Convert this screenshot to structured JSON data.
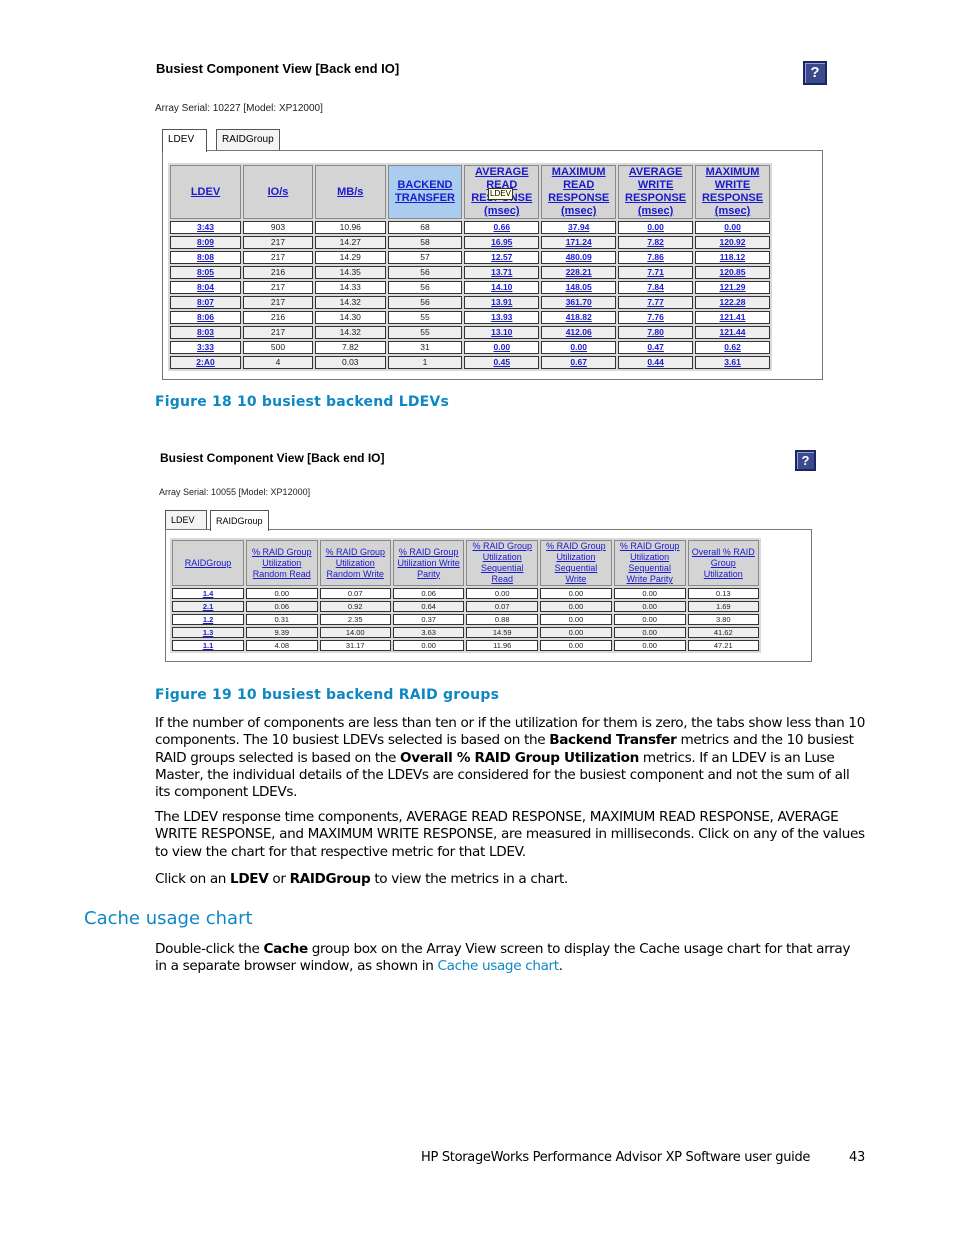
{
  "figure1": {
    "title": "Busiest Component View [Back end IO]",
    "serial": "Array Serial: 10227 [Model: XP12000]",
    "help_label": "?",
    "tabs": [
      {
        "label": "LDEV",
        "active": true
      },
      {
        "label": "RAIDGroup",
        "active": false
      }
    ],
    "tooltip": "LDEV",
    "columns": [
      "LDEV",
      "IO/s",
      "MB/s",
      "BACKEND TRANSFER",
      "AVERAGE READ RESPONSE (msec)",
      "MAXIMUM READ RESPONSE (msec)",
      "AVERAGE WRITE RESPONSE (msec)",
      "MAXIMUM WRITE RESPONSE (msec)"
    ],
    "highlighted_column": "BACKEND TRANSFER",
    "rows": [
      [
        "3:43",
        "903",
        "10.96",
        "68",
        "0.66",
        "37.94",
        "0.00",
        "0.00"
      ],
      [
        "8:09",
        "217",
        "14.27",
        "58",
        "16.95",
        "171.24",
        "7.82",
        "120.92"
      ],
      [
        "8:08",
        "217",
        "14.29",
        "57",
        "12.57",
        "480.09",
        "7.86",
        "118.12"
      ],
      [
        "8:05",
        "216",
        "14.35",
        "56",
        "13.71",
        "228.21",
        "7.71",
        "120.85"
      ],
      [
        "8:04",
        "217",
        "14.33",
        "56",
        "14.10",
        "148.05",
        "7.84",
        "121.29"
      ],
      [
        "8:07",
        "217",
        "14.32",
        "56",
        "13.91",
        "361.70",
        "7.77",
        "122.28"
      ],
      [
        "8:06",
        "216",
        "14.30",
        "55",
        "13.93",
        "418.82",
        "7.76",
        "121.41"
      ],
      [
        "8:03",
        "217",
        "14.32",
        "55",
        "13.10",
        "412.06",
        "7.80",
        "121.44"
      ],
      [
        "3:33",
        "500",
        "7.82",
        "31",
        "0.00",
        "0.00",
        "0.47",
        "0.62"
      ],
      [
        "2:A0",
        "4",
        "0.03",
        "1",
        "0.45",
        "0.67",
        "0.44",
        "3.61"
      ]
    ],
    "caption": "Figure 18 10 busiest backend LDEVs"
  },
  "figure2": {
    "title": "Busiest Component View [Back end IO]",
    "serial": "Array Serial: 10055 [Model: XP12000]",
    "help_label": "?",
    "tabs": [
      {
        "label": "LDEV",
        "active": false
      },
      {
        "label": "RAIDGroup",
        "active": true
      }
    ],
    "columns": [
      "RAIDGroup",
      "% RAID Group Utilization Random Read",
      "% RAID Group Utilization Random Write",
      "% RAID Group Utilization Write Parity",
      "% RAID Group Utilization Sequential Read",
      "% RAID Group Utilization Sequential Write",
      "% RAID Group Utilization Sequential Write Parity",
      "Overall % RAID Group Utilization"
    ],
    "rows": [
      [
        "1.4",
        "0.00",
        "0.07",
        "0.06",
        "0.00",
        "0.00",
        "0.00",
        "0.13"
      ],
      [
        "2.1",
        "0.06",
        "0.92",
        "0.64",
        "0.07",
        "0.00",
        "0.00",
        "1.69"
      ],
      [
        "1.2",
        "0.31",
        "2.35",
        "0.37",
        "0.88",
        "0.00",
        "0.00",
        "3.80"
      ],
      [
        "1.3",
        "9.39",
        "14.00",
        "3.63",
        "14.59",
        "0.00",
        "0.00",
        "41.62"
      ],
      [
        "1.1",
        "4.08",
        "31.17",
        "0.00",
        "11.96",
        "0.00",
        "0.00",
        "47.21"
      ]
    ],
    "caption": "Figure 19 10 busiest backend RAID groups"
  },
  "body": {
    "p1": {
      "t1": "If the number of components are less than ten or if the utilization for them is zero, the tabs show less than 10 components.  The 10 busiest LDEVs selected is based on the ",
      "b1": "Backend Transfer",
      "t2": " metrics and the 10 busiest RAID groups selected is based on the ",
      "b2": "Overall % RAID Group Utilization",
      "t3": " metrics.  If an LDEV is an Luse Master, the individual details of the LDEVs are considered for the busiest component and not the sum of all its component LDEVs."
    },
    "p2": "The LDEV response time components, AVERAGE READ RESPONSE, MAXIMUM READ RESPONSE, AVERAGE WRITE RESPONSE, and MAXIMUM WRITE RESPONSE, are measured in milliseconds.  Click on any of the values to view the chart for that respective metric for that LDEV.",
    "p3": {
      "t1": "Click on an ",
      "b1": "LDEV",
      "t2": " or ",
      "b2": "RAIDGroup",
      "t3": " to view the metrics in a chart."
    },
    "heading": "Cache usage chart",
    "p4": {
      "t1": "Double-click the ",
      "b1": "Cache",
      "t2": " group box on the Array View screen to display the Cache usage chart for that array in a separate browser window, as shown in ",
      "link": "Cache usage chart",
      "t3": "."
    }
  },
  "footer": {
    "guide_title": "HP StorageWorks Performance Advisor XP Software user guide",
    "page_number": "43"
  }
}
